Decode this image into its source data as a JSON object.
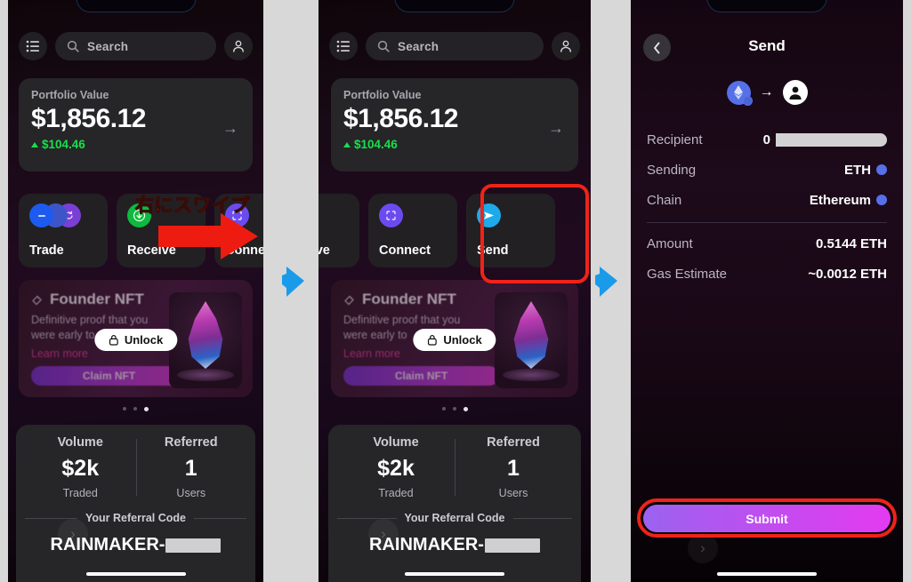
{
  "meta": {
    "gap_color": "#d8d8d8",
    "highlight_color": "#ef2318",
    "accent_green": "#16e04b"
  },
  "annotation": {
    "swipe_text": "右にスワイプ",
    "step_arrow_icon": "chevron-right-arrow-icon"
  },
  "wallet": {
    "topbar": {
      "menu_icon": "list-menu-icon",
      "search_icon": "search-icon",
      "search_placeholder": "Search",
      "profile_icon": "person-icon"
    },
    "portfolio": {
      "label": "Portfolio Value",
      "value": "$1,856.12",
      "delta": "$104.46",
      "delta_direction": "up",
      "arrow_icon": "arrow-right-icon"
    },
    "actions": [
      {
        "label": "Trade",
        "icon": "trade-stacked-tokens-icon"
      },
      {
        "label": "Receive",
        "icon": "download-circle-icon"
      },
      {
        "label": "Connect",
        "icon": "scan-connect-icon"
      },
      {
        "label": "Send",
        "icon": "paper-plane-icon"
      }
    ],
    "nft_card": {
      "tag_icon": "tag-icon",
      "title": "Founder NFT",
      "description": "Definitive proof that you were early to",
      "learn_more": "Learn more",
      "claim_label": "Claim NFT",
      "unlock_label": "Unlock",
      "lock_icon": "lock-icon",
      "art_icon": "nft-water-drop-art"
    },
    "carousel": {
      "total_dots": 3,
      "active_index": 2
    },
    "stats": {
      "columns": [
        {
          "head": "Volume",
          "value": "$2k",
          "sub": "Traded"
        },
        {
          "head": "Referred",
          "value": "1",
          "sub": "Users"
        }
      ],
      "referral_title": "Your Referral Code",
      "referral_code": "RAINMAKER-",
      "referral_code_redacted": true
    }
  },
  "send_screen": {
    "back_icon": "chevron-left-icon",
    "title": "Send",
    "from_icon": "ethereum-token-icon",
    "transfer_arrow_icon": "arrow-right-icon",
    "to_icon": "person-avatar-icon",
    "rows": [
      {
        "key": "Recipient",
        "value": "0",
        "redacted": true
      },
      {
        "key": "Sending",
        "value": "ETH",
        "chip": true
      },
      {
        "key": "Chain",
        "value": "Ethereum",
        "chip": true
      }
    ],
    "rows2": [
      {
        "key": "Amount",
        "value": "0.5144 ETH"
      },
      {
        "key": "Gas Estimate",
        "value": "~0.0012 ETH"
      }
    ],
    "submit_label": "Submit"
  }
}
